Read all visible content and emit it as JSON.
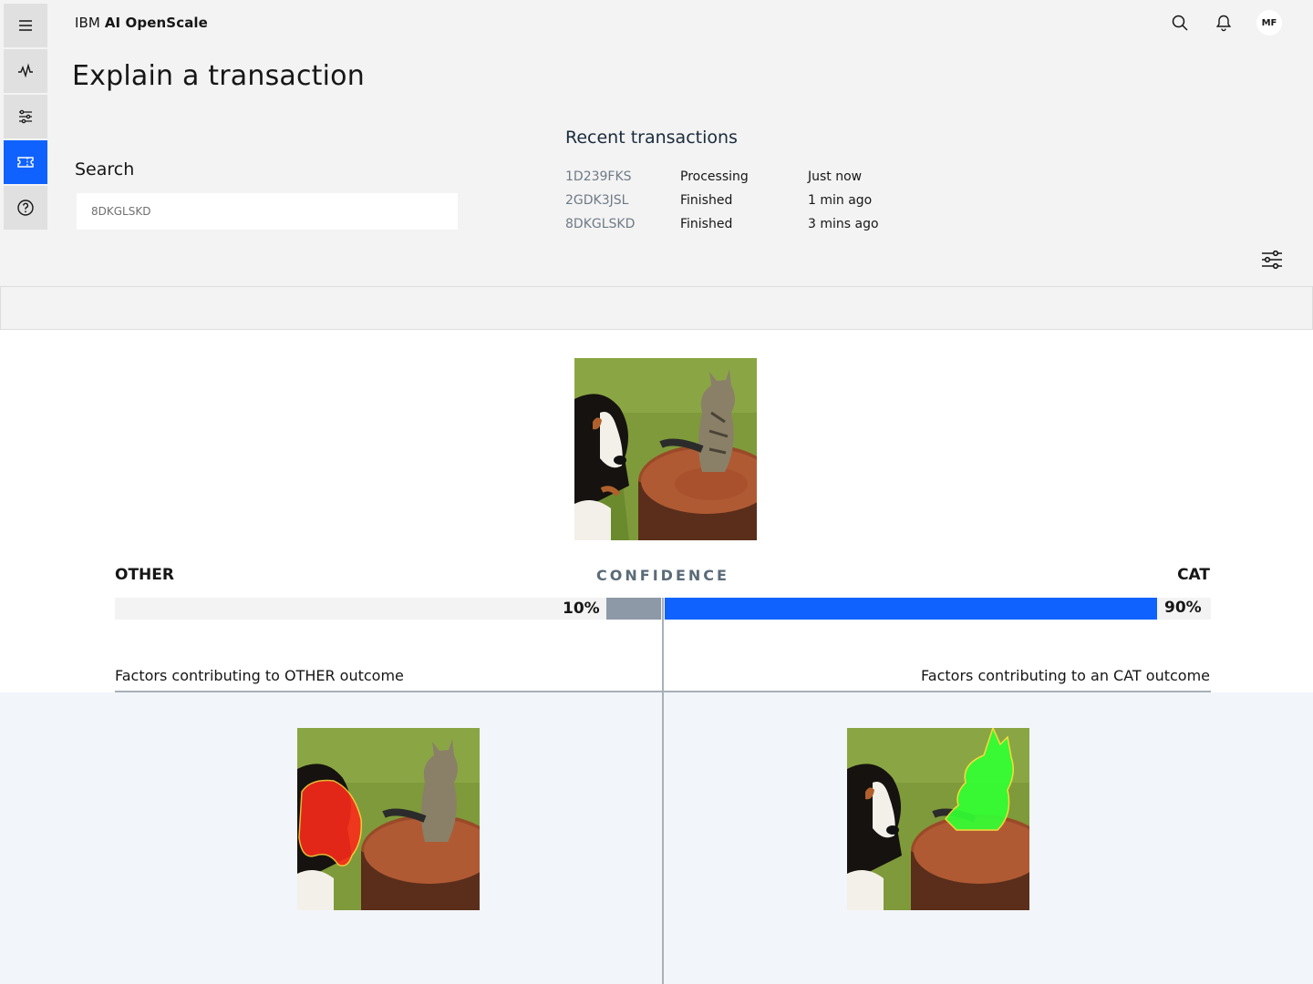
{
  "app": {
    "brand_prefix": "IBM",
    "brand_name": "AI OpenScale",
    "user_initials": "MF"
  },
  "rail": {
    "items": [
      {
        "icon": "menu-icon",
        "active": false
      },
      {
        "icon": "activity-icon",
        "active": false
      },
      {
        "icon": "settings-sliders-icon",
        "active": false
      },
      {
        "icon": "ticket-icon",
        "active": true
      },
      {
        "icon": "help-icon",
        "active": false
      }
    ]
  },
  "header": {
    "icons": [
      "search-icon",
      "notification-icon"
    ]
  },
  "page": {
    "title": "Explain a transaction"
  },
  "search": {
    "label": "Search",
    "value": "8DKGLSKD"
  },
  "recent": {
    "title": "Recent transactions",
    "rows": [
      {
        "id": "1D239FKS",
        "status": "Processing",
        "time": "Just now"
      },
      {
        "id": "2GDK3JSL",
        "status": "Finished",
        "time": "1 min ago"
      },
      {
        "id": "8DKGLSKD",
        "status": "Finished",
        "time": "3 mins ago"
      }
    ]
  },
  "confidence": {
    "heading": "CONFIDENCE",
    "other_label": "OTHER",
    "cat_label": "CAT",
    "other_pct_text": "10%",
    "cat_pct_text": "90%",
    "other_value": 0.1,
    "cat_value": 0.9
  },
  "factors": {
    "other_title": "Factors contributing to OTHER outcome",
    "cat_title": "Factors contributing to an CAT outcome"
  },
  "colors": {
    "accent": "#0f62fe",
    "other_bar": "#8d99a6",
    "other_highlight": "#ff2a1a",
    "cat_highlight": "#33ff33"
  }
}
